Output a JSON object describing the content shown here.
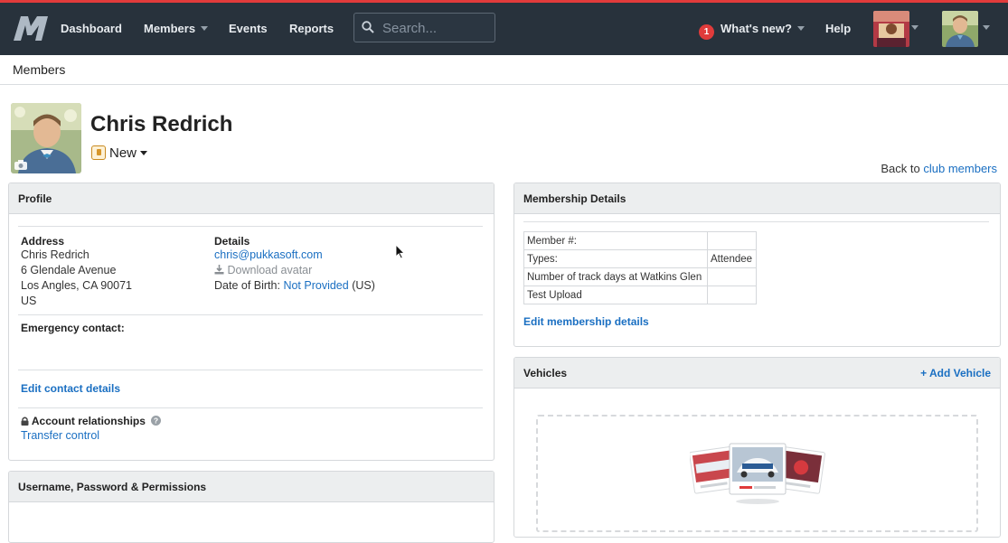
{
  "nav": {
    "items": [
      {
        "label": "Dashboard"
      },
      {
        "label": "Members"
      },
      {
        "label": "Events"
      },
      {
        "label": "Reports"
      }
    ],
    "search_placeholder": "Search...",
    "whats_new_count": "1",
    "whats_new_label": "What's new?",
    "help_label": "Help"
  },
  "breadcrumb": {
    "label": "Members"
  },
  "member": {
    "name": "Chris Redrich",
    "status": "New"
  },
  "back": {
    "prefix": "Back to",
    "link": "club members"
  },
  "profile": {
    "title": "Profile",
    "address_label": "Address",
    "address_lines": [
      "Chris Redrich",
      "6 Glendale Avenue",
      "Los Angles, CA 90071",
      "US"
    ],
    "details_label": "Details",
    "email": "chris@pukkasoft.com",
    "download_avatar": "Download avatar",
    "dob_label": "Date of Birth:",
    "dob_value": "Not Provided",
    "dob_suffix": "(US)",
    "emergency_label": "Emergency contact:",
    "edit_contact": "Edit contact details",
    "relationships_label": "Account relationships",
    "transfer_control": "Transfer control"
  },
  "permissions": {
    "title": "Username, Password & Permissions"
  },
  "membership": {
    "title": "Membership Details",
    "rows": [
      {
        "field": "Member #:",
        "value": ""
      },
      {
        "field": "Types:",
        "value": "Attendee"
      },
      {
        "field": "Number of track days at Watkins Glen",
        "value": ""
      },
      {
        "field": "Test Upload",
        "value": ""
      }
    ],
    "edit_link": "Edit membership details"
  },
  "vehicles": {
    "title": "Vehicles",
    "add_label": "+ Add Vehicle"
  },
  "colors": {
    "nav_bg": "#28323c",
    "accent_red": "#e23b3b",
    "link_blue": "#1a6fc2"
  }
}
